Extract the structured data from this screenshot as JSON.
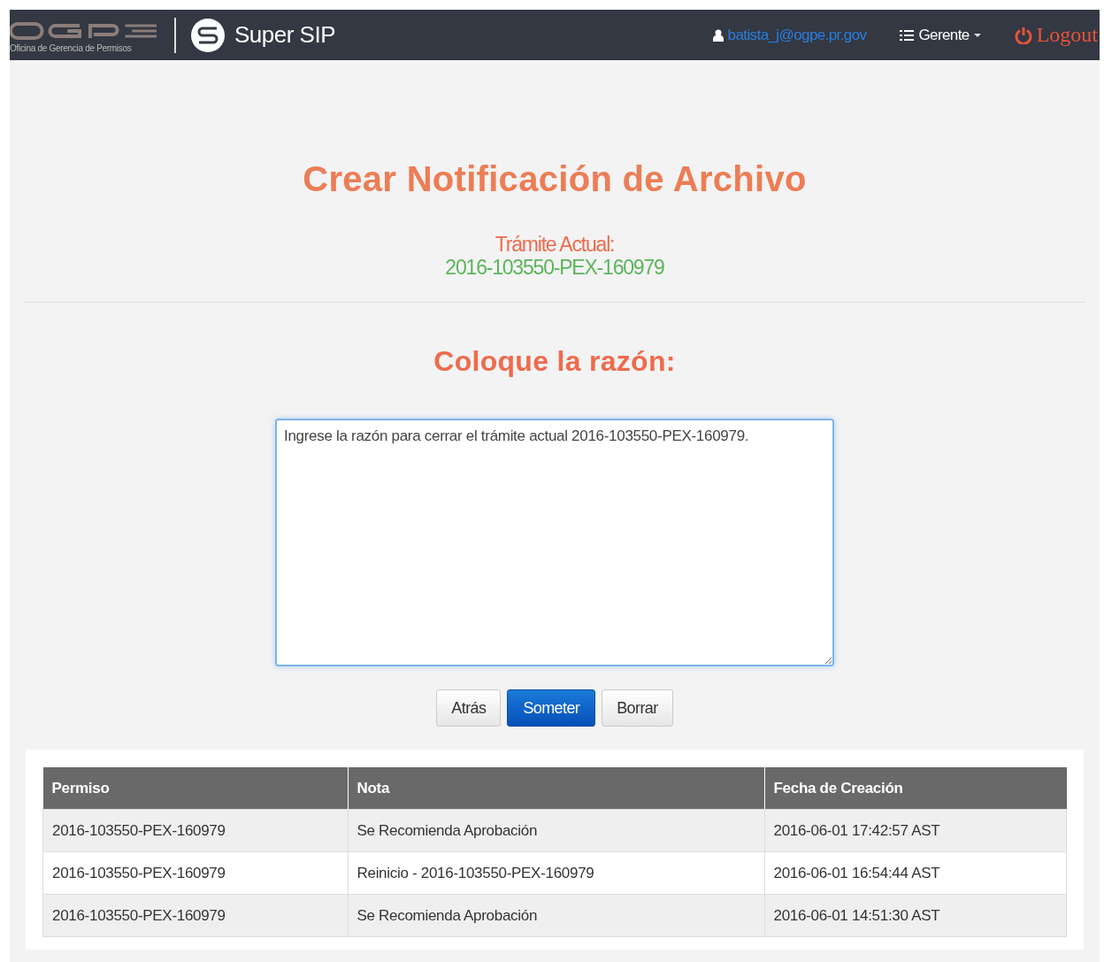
{
  "navbar": {
    "logo_subtitle": "Oficina de Gerencia de Permisos",
    "app_name": "Super SIP",
    "user_email": "batista_j@ogpe.pr.gov",
    "role_menu": "Gerente",
    "logout": "Logout"
  },
  "page_title": "Crear Notificación de Archivo",
  "current_label": "Trámite Actual:",
  "current_value": "2016-103550-PEX-160979",
  "reason_heading": "Coloque la razón:",
  "reason_field": {
    "value": "Ingrese la razón para cerrar el trámite actual 2016-103550-PEX-160979."
  },
  "buttons": [
    {
      "label": "Atrás",
      "kind": "default"
    },
    {
      "label": "Someter",
      "kind": "primary"
    },
    {
      "label": "Borrar",
      "kind": "default"
    }
  ],
  "table": {
    "columns": [
      "Permiso",
      "Nota",
      "Fecha de Creación"
    ],
    "rows": [
      [
        "2016-103550-PEX-160979",
        "Se Recomienda Aprobación",
        "2016-06-01 17:42:57 AST"
      ],
      [
        "2016-103550-PEX-160979",
        "Reinicio - 2016-103550-PEX-160979",
        "2016-06-01 16:54:44 AST"
      ],
      [
        "2016-103550-PEX-160979",
        "Se Recomienda Aprobación",
        "2016-06-01 14:51:30 AST"
      ]
    ]
  }
}
